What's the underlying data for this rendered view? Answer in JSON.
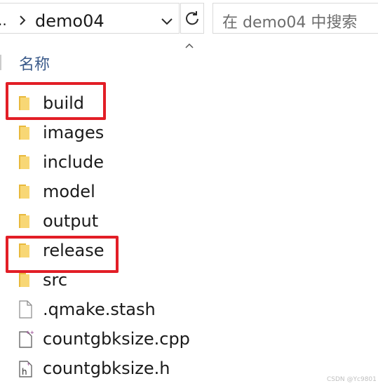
{
  "breadcrumb": {
    "ellipsis": "..",
    "current": "demo04"
  },
  "search": {
    "placeholder": "在 demo04 中搜索"
  },
  "column_header": {
    "name_label": "名称"
  },
  "files": [
    {
      "name": "build",
      "kind": "folder",
      "icon": "folder-icon",
      "highlighted": true
    },
    {
      "name": "images",
      "kind": "folder",
      "icon": "folder-icon",
      "highlighted": false
    },
    {
      "name": "include",
      "kind": "folder",
      "icon": "folder-icon",
      "highlighted": false
    },
    {
      "name": "model",
      "kind": "folder",
      "icon": "folder-icon",
      "highlighted": false
    },
    {
      "name": "output",
      "kind": "folder",
      "icon": "folder-icon",
      "highlighted": false
    },
    {
      "name": "release",
      "kind": "folder",
      "icon": "folder-icon",
      "highlighted": true
    },
    {
      "name": "src",
      "kind": "folder",
      "icon": "folder-icon",
      "highlighted": false
    },
    {
      "name": ".qmake.stash",
      "kind": "file",
      "icon": "blank-file-icon",
      "highlighted": false
    },
    {
      "name": "countgbksize.cpp",
      "kind": "cpp",
      "icon": "cpp-file-icon",
      "highlighted": false
    },
    {
      "name": "countgbksize.h",
      "kind": "header",
      "icon": "header-file-icon",
      "highlighted": false
    }
  ],
  "watermark": "CSDN @Yc9801",
  "colors": {
    "highlight": "#e21e26",
    "folder": "#f8d775",
    "column_header_text": "#3a5a8a",
    "cpp_badge": "#9b4f96"
  }
}
